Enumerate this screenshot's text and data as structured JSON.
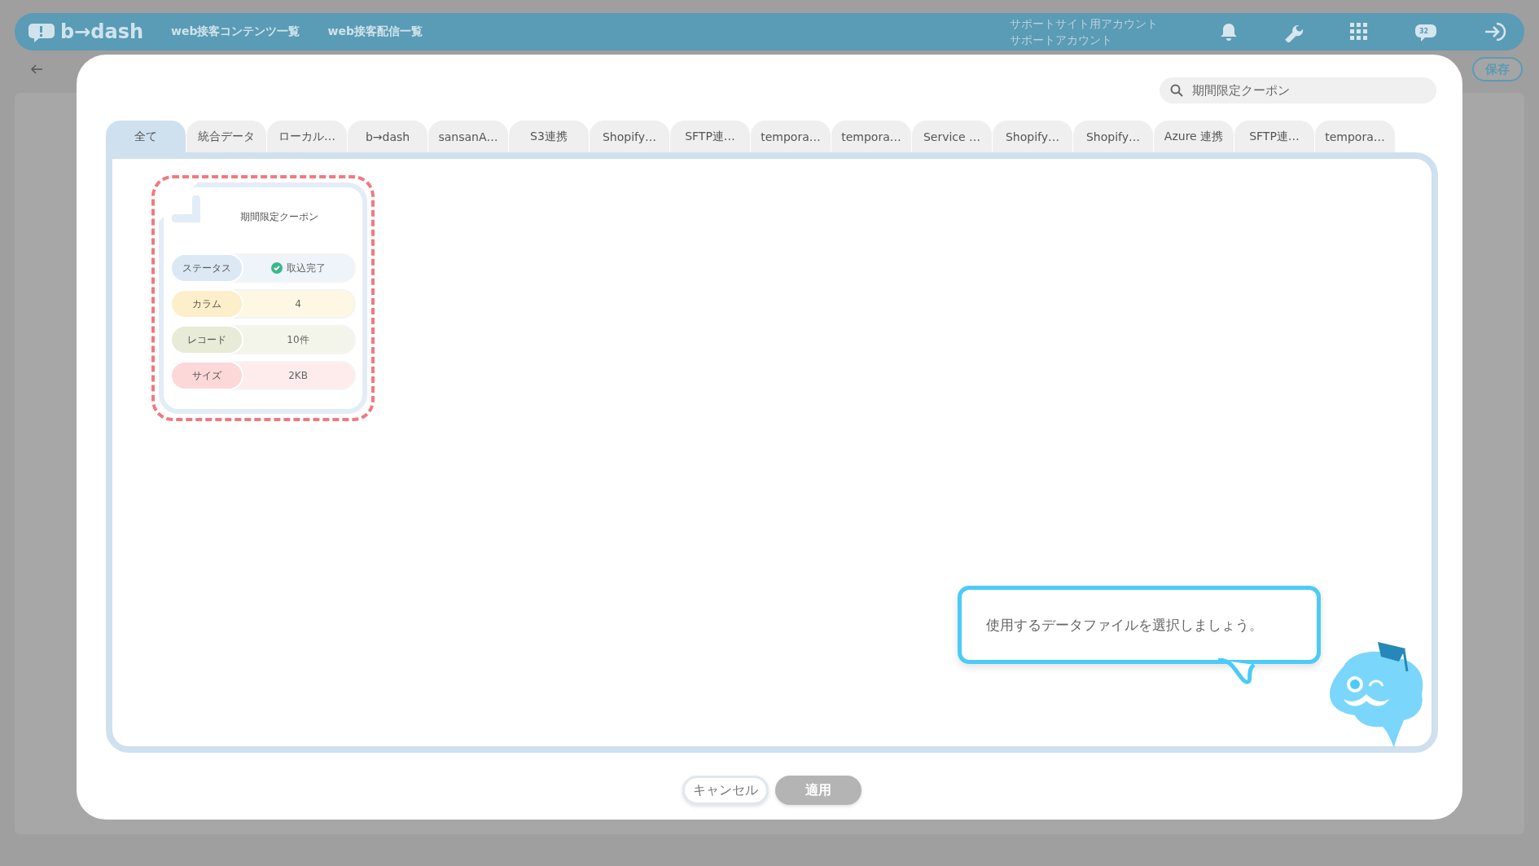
{
  "header": {
    "logo": "b→dash",
    "nav": [
      "web接客コンテンツ一覧",
      "web接客配信一覧"
    ],
    "account": [
      "サポートサイト用アカウント",
      "サポートアカウント"
    ],
    "notification_badge": "32"
  },
  "subbar": {
    "save_button": "保存"
  },
  "modal": {
    "search": {
      "value": "期間限定クーポン"
    },
    "tabs": [
      {
        "label": "全て",
        "selected": true
      },
      {
        "label": "統合データ",
        "selected": false
      },
      {
        "label": "ローカル…",
        "selected": false
      },
      {
        "label": "b→dash",
        "selected": false
      },
      {
        "label": "sansanA…",
        "selected": false
      },
      {
        "label": "S3連携",
        "selected": false
      },
      {
        "label": "Shopify…",
        "selected": false
      },
      {
        "label": "SFTP連…",
        "selected": false
      },
      {
        "label": "tempora…",
        "selected": false
      },
      {
        "label": "tempora…",
        "selected": false
      },
      {
        "label": "Service …",
        "selected": false
      },
      {
        "label": "Shopify…",
        "selected": false
      },
      {
        "label": "Shopify…",
        "selected": false
      },
      {
        "label": "Azure 連携",
        "selected": false
      },
      {
        "label": "SFTP連…",
        "selected": false
      },
      {
        "label": "tempora…",
        "selected": false
      }
    ],
    "files": [
      {
        "title": "期間限定クーポン",
        "selected": true,
        "rows": [
          {
            "kind": "status",
            "label": "ステータス",
            "value": "取込完了",
            "color": "#dce9f5"
          },
          {
            "kind": "plain",
            "label": "カラム",
            "value": "4",
            "color": "#fcefc9"
          },
          {
            "kind": "plain",
            "label": "レコード",
            "value": "10件",
            "color": "#e7ebd7"
          },
          {
            "kind": "plain",
            "label": "サイズ",
            "value": "2KB",
            "color": "#fcd8d8"
          }
        ]
      }
    ],
    "hint": "使用するデータファイルを選択しましょう。",
    "buttons": [
      {
        "label": "キャンセル",
        "disabled": false
      },
      {
        "label": "適用",
        "disabled": true
      }
    ]
  }
}
